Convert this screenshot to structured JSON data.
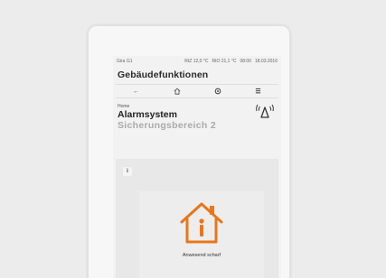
{
  "status": {
    "device": "Gira G1",
    "temp_indoor": "RtZ 12,0 °C",
    "temp_outdoor": "RtO 21,1 °C",
    "time": "08:00",
    "date": "18.03.2016"
  },
  "header": {
    "title": "Gebäudefunktionen"
  },
  "nav": {
    "back_icon": "back-arrow",
    "home_icon": "home",
    "settings_icon": "settings",
    "menu_icon": "menu"
  },
  "breadcrumb": "Home",
  "page": {
    "title": "Alarmsystem",
    "subtitle": "Sicherungsbereich 2"
  },
  "panel": {
    "info_label": "i",
    "alarm_state": "Anwesend scharf",
    "accent_color": "#e8761c"
  }
}
